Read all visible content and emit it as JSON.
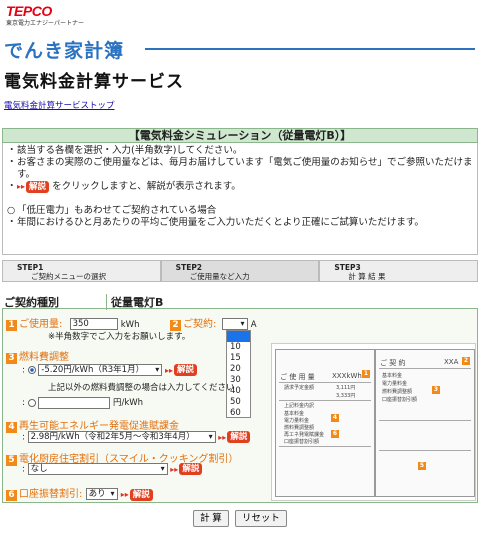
{
  "header": {
    "logo": "TEPCO",
    "logo_sub": "東京電力エナジーパートナー",
    "brand": "でんき家計簿",
    "title": "電気料金計算サービス",
    "top_link": "電気料金計算サービストップ"
  },
  "sim": {
    "heading": "【電気料金シミュレーション（従量電灯B）】",
    "notes": [
      "該当する各欄を選択・入力(半角数字)してください。",
      "お客さまの実際のご使用量などは、毎月お届けしています「電気ご使用量のお知らせ」でご参照いただけます。"
    ],
    "note_kaisetsu_after": "をクリックしますと、解説が表示されます。",
    "notes2": [
      "「低圧電力」もあわせてご契約されている場合",
      "年間におけるひと月あたりの平均ご使用量をご入力いただくとより正確にご試算いただけます。"
    ]
  },
  "kaisetsu_label": "解説",
  "steps": [
    {
      "num": "STEP1",
      "label": "ご契約メニューの選択"
    },
    {
      "num": "STEP2",
      "label": "ご使用量など入力"
    },
    {
      "num": "STEP3",
      "label": "計 算 結 果"
    }
  ],
  "form": {
    "contract_type_label": "ご契約種別",
    "contract_type_value": "従量電灯B",
    "usage": {
      "num": "1",
      "label": "ご使用量:",
      "value": "350",
      "unit": "kWh",
      "note": "※半角数字でご入力をお願いします。"
    },
    "contract": {
      "num": "2",
      "label": "ご契約:",
      "value": "",
      "unit": "A",
      "options": [
        "10",
        "15",
        "20",
        "30",
        "40",
        "50",
        "60"
      ]
    },
    "fuel": {
      "num": "3",
      "label": "燃料費調整",
      "option1": "-5.20円/kWh（R3年1月）",
      "other_text": "上記以外の燃料費調整の場合は入力してください",
      "other_unit": "円/kWh"
    },
    "renewable": {
      "num": "4",
      "label": "再生可能エネルギー発電促進賦課金",
      "value": "2.98円/kWh（令和2年5月〜令和3年4月）"
    },
    "discount": {
      "num": "5",
      "label": "電化厨房住宅割引（スマイル・クッキング割引）",
      "value": "なし"
    },
    "bank": {
      "num": "6",
      "label": "口座振替割引:",
      "value": "あり"
    }
  },
  "bill_image": {
    "left_head": "ご 使 用 量",
    "left_values": [
      "XXXkWh",
      "3,111円",
      "3,333円"
    ],
    "left_rows": [
      "請求予定金額",
      "上記料金内訳",
      "基本料金",
      "電力量料金",
      "燃料費調整額",
      "再エネ発電賦課金",
      "口座振替割引額"
    ],
    "right_head": "ご 契 約",
    "right_value": "XXA",
    "right_rows": [
      "基本料金",
      "電力量料金",
      "燃料費調整額",
      "口座振替割引額"
    ]
  },
  "buttons": {
    "calc": "計 算",
    "reset": "リセット"
  }
}
